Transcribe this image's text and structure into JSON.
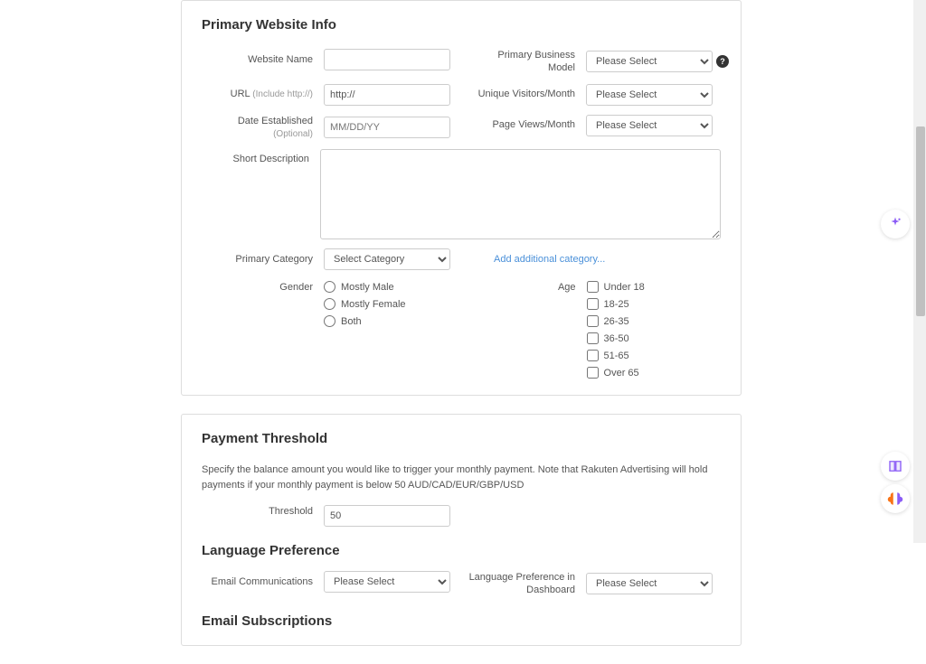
{
  "primary": {
    "title": "Primary Website Info",
    "websiteName": {
      "label": "Website Name",
      "value": ""
    },
    "url": {
      "label": "URL",
      "sublabel": "(Include http://)",
      "value": "http://"
    },
    "dateEstablished": {
      "label": "Date Established",
      "sublabel": "(Optional)",
      "placeholder": "MM/DD/YY",
      "value": ""
    },
    "businessModel": {
      "label": "Primary Business Model",
      "selected": "Please Select"
    },
    "uniqueVisitors": {
      "label": "Unique Visitors/Month",
      "selected": "Please Select"
    },
    "pageViews": {
      "label": "Page Views/Month",
      "selected": "Please Select"
    },
    "shortDescription": {
      "label": "Short Description",
      "value": ""
    },
    "primaryCategory": {
      "label": "Primary Category",
      "selected": "Select Category"
    },
    "addCategoryLink": "Add additional category...",
    "gender": {
      "label": "Gender",
      "options": [
        "Mostly Male",
        "Mostly Female",
        "Both"
      ]
    },
    "age": {
      "label": "Age",
      "options": [
        "Under 18",
        "18-25",
        "26-35",
        "36-50",
        "51-65",
        "Over 65"
      ]
    }
  },
  "payment": {
    "title": "Payment Threshold",
    "description": "Specify the balance amount you would like to trigger your monthly payment. Note that Rakuten Advertising will hold payments if your monthly payment is below 50 AUD/CAD/EUR/GBP/USD",
    "threshold": {
      "label": "Threshold",
      "value": "50"
    }
  },
  "language": {
    "title": "Language Preference",
    "emailComms": {
      "label": "Email Communications",
      "selected": "Please Select"
    },
    "dashboardLang": {
      "label": "Language Preference in Dashboard",
      "selected": "Please Select"
    }
  },
  "emailSubs": {
    "title": "Email Subscriptions"
  }
}
